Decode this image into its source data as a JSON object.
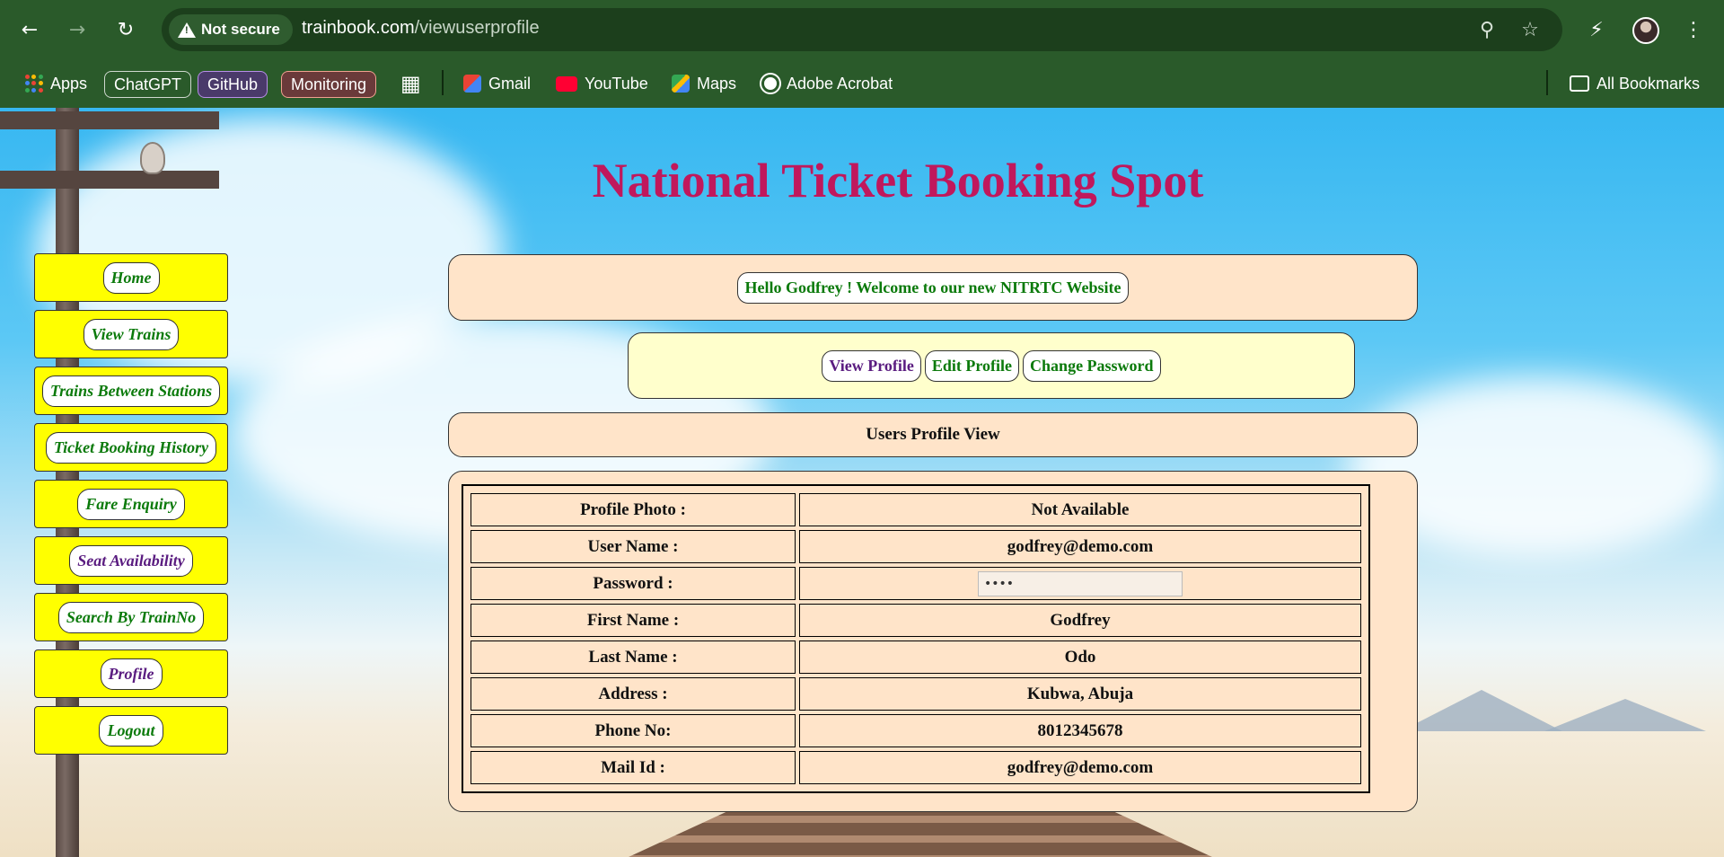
{
  "browser": {
    "security_label": "Not secure",
    "url_host": "trainbook.com",
    "url_path": "/viewuserprofile",
    "bookmarks": {
      "apps": "Apps",
      "chips": [
        "ChatGPT",
        "GitHub",
        "Monitoring"
      ],
      "links": [
        "Gmail",
        "YouTube",
        "Maps",
        "Adobe Acrobat"
      ],
      "all_bookmarks": "All Bookmarks"
    }
  },
  "site": {
    "title": "National Ticket Booking Spot"
  },
  "sidebar": {
    "items": [
      {
        "label": "Home"
      },
      {
        "label": "View Trains"
      },
      {
        "label": "Trains Between Stations"
      },
      {
        "label": "Ticket Booking History"
      },
      {
        "label": "Fare Enquiry"
      },
      {
        "label": "Seat Availability"
      },
      {
        "label": "Search By TrainNo"
      },
      {
        "label": "Profile"
      },
      {
        "label": "Logout"
      }
    ]
  },
  "welcome": {
    "message": "Hello Godfrey ! Welcome to our new NITRTC Website"
  },
  "profile_tabs": [
    "View Profile",
    "Edit Profile",
    "Change Password"
  ],
  "profile_view": {
    "heading": "Users Profile View",
    "rows": [
      {
        "label": "Profile Photo :",
        "value": "Not Available"
      },
      {
        "label": "User Name :",
        "value": "godfrey@demo.com"
      },
      {
        "label": "Password :",
        "value": "••••"
      },
      {
        "label": "First Name :",
        "value": "Godfrey"
      },
      {
        "label": "Last Name :",
        "value": "Odo"
      },
      {
        "label": "Address :",
        "value": "Kubwa, Abuja"
      },
      {
        "label": "Phone No:",
        "value": "8012345678"
      },
      {
        "label": "Mail Id :",
        "value": "godfrey@demo.com"
      }
    ]
  },
  "colors": {
    "title": "#c0185c",
    "menu_bg": "#ffff00",
    "link": "#0b7a0b",
    "visited_link": "#5a1c80",
    "panel_peach": "#ffe4c9",
    "panel_cream": "#ffffcc",
    "chrome": "#2a5a2a"
  }
}
